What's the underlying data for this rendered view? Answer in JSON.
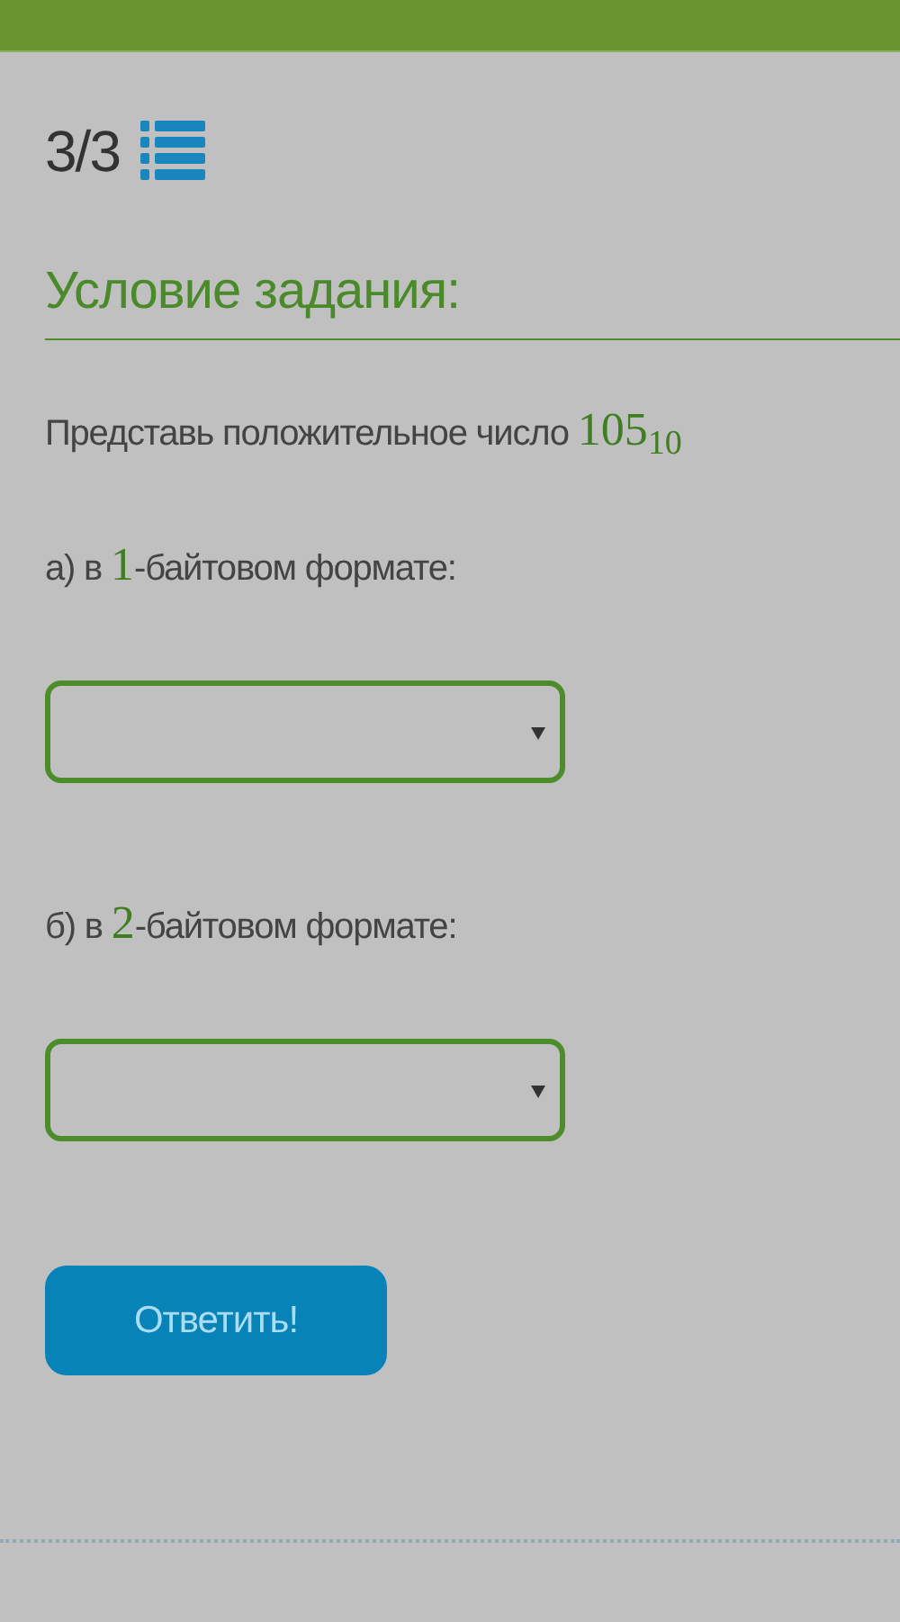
{
  "counter": "3/3",
  "section_title": "Условие задания:",
  "prompt": {
    "text": "Представь положительное число ",
    "number": "105",
    "base": "10"
  },
  "parts": [
    {
      "prefix": "а) в ",
      "number": "1",
      "suffix": "-байтовом формате:"
    },
    {
      "prefix": "б) в ",
      "number": "2",
      "suffix": "-байтовом формате:"
    }
  ],
  "submit_button": "Ответить!"
}
